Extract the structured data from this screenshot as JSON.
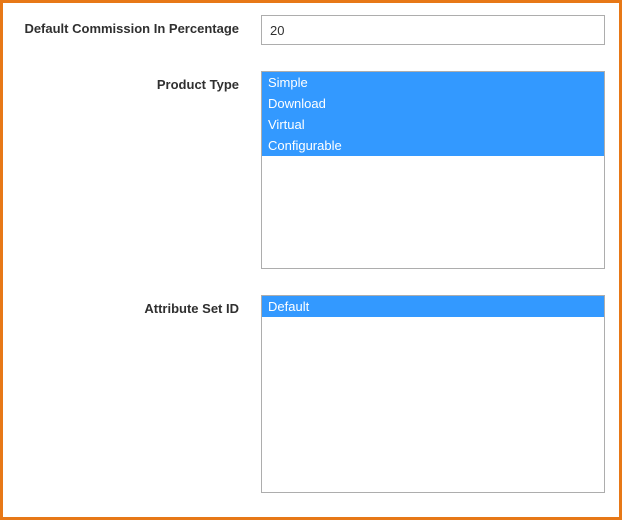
{
  "form": {
    "commission": {
      "label": "Default Commission In Percentage",
      "value": "20"
    },
    "product_type": {
      "label": "Product Type",
      "options": [
        {
          "label": "Simple",
          "selected": true
        },
        {
          "label": "Download",
          "selected": true
        },
        {
          "label": "Virtual",
          "selected": true
        },
        {
          "label": "Configurable",
          "selected": true
        }
      ]
    },
    "attribute_set": {
      "label": "Attribute Set ID",
      "options": [
        {
          "label": "Default",
          "selected": true
        }
      ]
    }
  }
}
